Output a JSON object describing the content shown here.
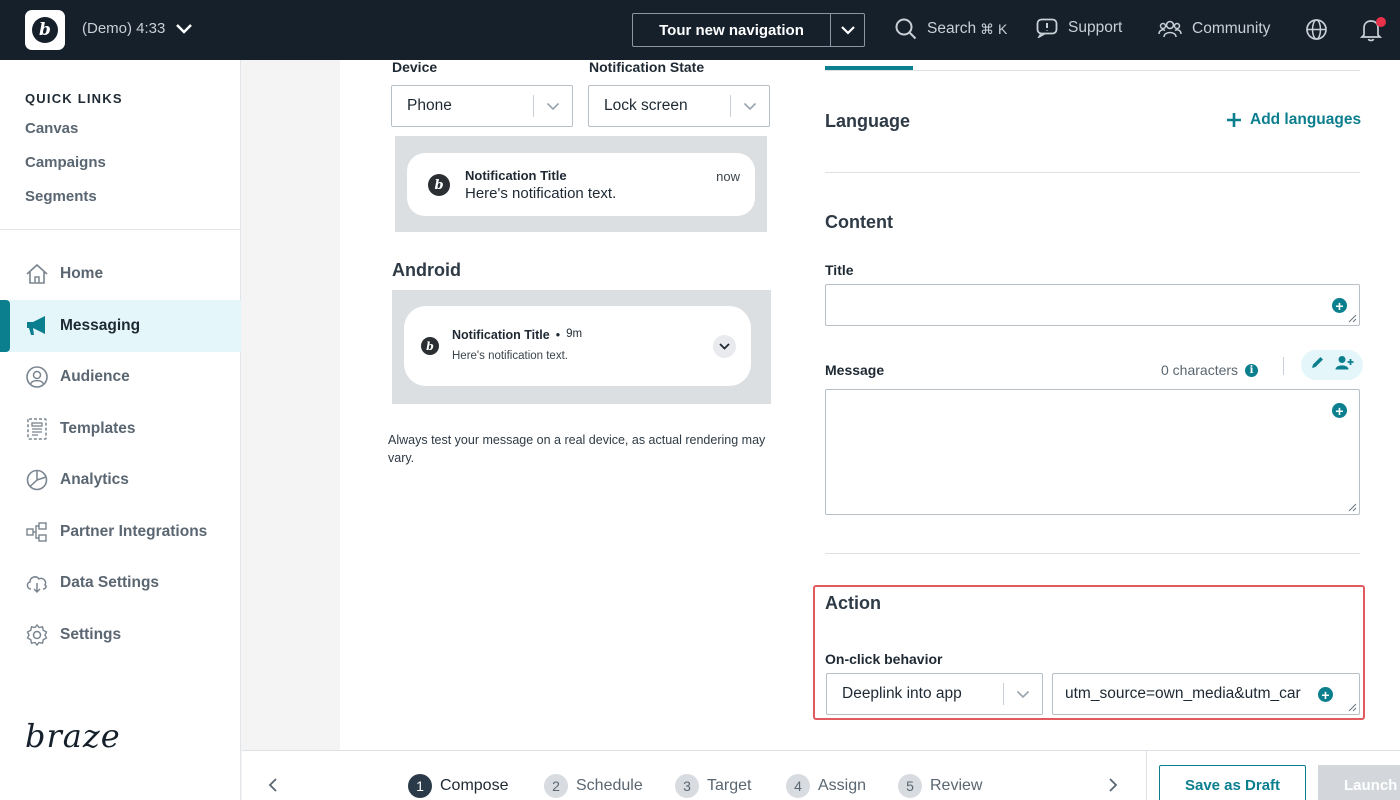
{
  "topbar": {
    "workspace": "(Demo) 4:33",
    "tour_label": "Tour new navigation",
    "search_label": "Search",
    "search_shortcut": "⌘ K",
    "support_label": "Support",
    "community_label": "Community"
  },
  "sidebar": {
    "quick_links_title": "QUICK LINKS",
    "quick_links": [
      "Canvas",
      "Campaigns",
      "Segments"
    ],
    "nav": [
      {
        "label": "Home",
        "icon": "home-icon"
      },
      {
        "label": "Messaging",
        "icon": "megaphone-icon",
        "active": true
      },
      {
        "label": "Audience",
        "icon": "audience-icon"
      },
      {
        "label": "Templates",
        "icon": "templates-icon"
      },
      {
        "label": "Analytics",
        "icon": "analytics-icon"
      },
      {
        "label": "Partner Integrations",
        "icon": "partner-integrations-icon"
      },
      {
        "label": "Data Settings",
        "icon": "data-settings-icon"
      },
      {
        "label": "Settings",
        "icon": "settings-gear-icon"
      }
    ],
    "brand": "braze"
  },
  "preview": {
    "device_label": "Device",
    "device_value": "Phone",
    "state_label": "Notification State",
    "state_value": "Lock screen",
    "ios": {
      "title": "Notification Title",
      "text": "Here's notification text.",
      "time": "now"
    },
    "android_heading": "Android",
    "android": {
      "title": "Notification Title",
      "dot": "•",
      "time": "9m",
      "text": "Here's notification text."
    },
    "disclaimer": "Always test your message on a real device, as actual rendering may vary."
  },
  "compose": {
    "language_heading": "Language",
    "add_languages": "Add languages",
    "content_heading": "Content",
    "title_label": "Title",
    "message_label": "Message",
    "char_count": "0 characters",
    "action_heading": "Action",
    "onclick_label": "On-click behavior",
    "onclick_value": "Deeplink into app",
    "deeplink_value": "utm_source=own_media&utm_car"
  },
  "footer": {
    "steps": [
      {
        "num": "1",
        "label": "Compose",
        "active": true
      },
      {
        "num": "2",
        "label": "Schedule"
      },
      {
        "num": "3",
        "label": "Target"
      },
      {
        "num": "4",
        "label": "Assign"
      },
      {
        "num": "5",
        "label": "Review"
      }
    ],
    "save_draft": "Save as Draft",
    "launch": "Launch"
  },
  "colors": {
    "accent": "#0c7f8f",
    "topbar": "#15202b",
    "highlight": "#e05a5f",
    "notification_dot": "#e8314a"
  }
}
